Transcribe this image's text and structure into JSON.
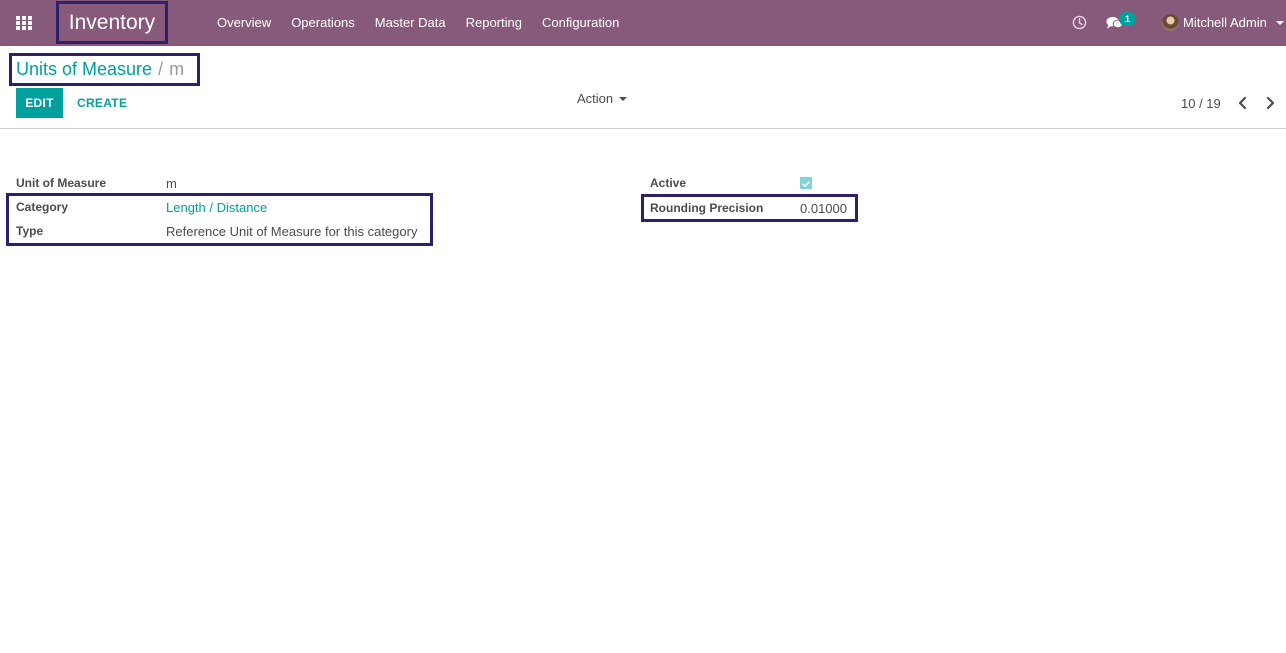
{
  "navbar": {
    "brand": "Inventory",
    "menu": [
      "Overview",
      "Operations",
      "Master Data",
      "Reporting",
      "Configuration"
    ],
    "icons": {
      "apps": "apps-grid-icon",
      "activity": "clock-icon",
      "messages": "chat-icon"
    },
    "chat_count": "1",
    "user_name": "Mitchell Admin"
  },
  "breadcrumb": {
    "parent": "Units of Measure",
    "separator": "/",
    "current": "m"
  },
  "toolbar": {
    "edit_label": "EDIT",
    "create_label": "CREATE",
    "action_label": "Action"
  },
  "pager": {
    "value": "10 / 19"
  },
  "form": {
    "uom_label": "Unit of Measure",
    "uom_value": "m",
    "category_label": "Category",
    "category_value": "Length / Distance",
    "type_label": "Type",
    "type_value": "Reference Unit of Measure for this category",
    "active_label": "Active",
    "active_checked": true,
    "rounding_label": "Rounding Precision",
    "rounding_value": "0.01000"
  },
  "colors": {
    "navbar": "#875a7b",
    "accent": "#00a09d",
    "highlight_border": "#2e1f66",
    "text": "#4c4c4c"
  }
}
